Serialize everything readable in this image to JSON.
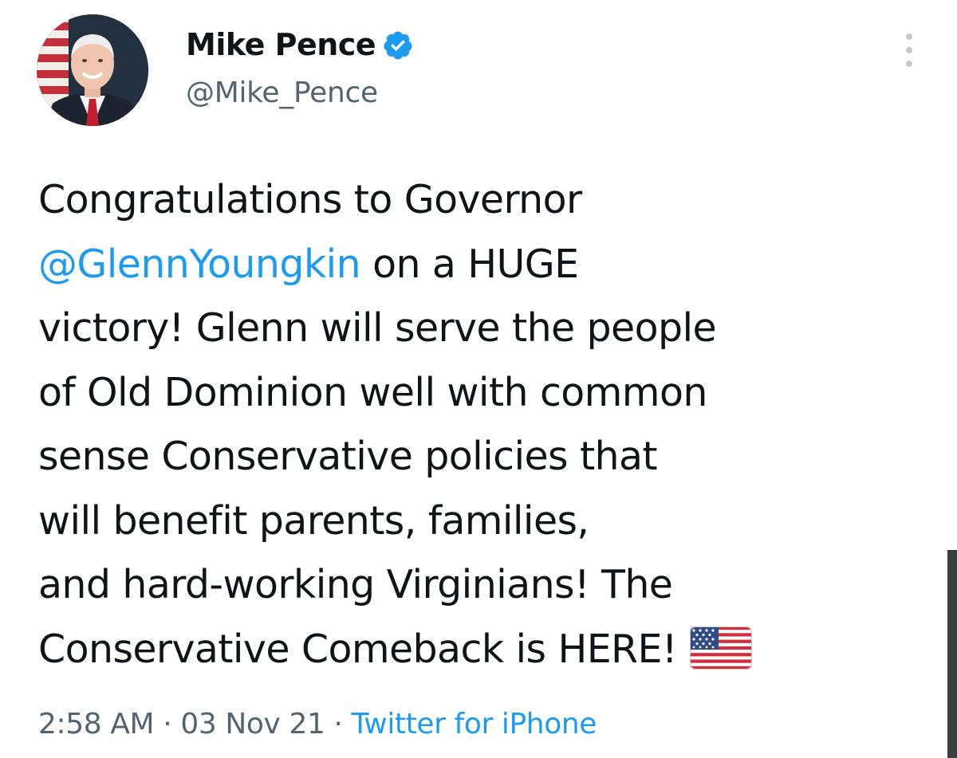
{
  "author": {
    "display_name": "Mike Pence",
    "handle": "@Mike_Pence",
    "verified": true
  },
  "tweet": {
    "lines": [
      {
        "pre": "Congratulations to Governor",
        "mention": "",
        "post": ""
      },
      {
        "pre": "",
        "mention": "@GlennYoungkin",
        "post": " on a HUGE"
      },
      {
        "pre": "victory! Glenn will serve the people",
        "mention": "",
        "post": ""
      },
      {
        "pre": "of Old Dominion well with common",
        "mention": "",
        "post": ""
      },
      {
        "pre": "sense Conservative policies that",
        "mention": "",
        "post": ""
      },
      {
        "pre": "will benefit parents, families,",
        "mention": "",
        "post": ""
      },
      {
        "pre": "and hard-working Virginians! The",
        "mention": "",
        "post": ""
      },
      {
        "pre": "Conservative Comeback is HERE!",
        "mention": "",
        "post": ""
      }
    ],
    "emoji": "us-flag-emoji"
  },
  "meta": {
    "time": "2:58 AM",
    "separator": "·",
    "date": "03 Nov 21",
    "source": "Twitter for iPhone"
  },
  "colors": {
    "text": "#0f1419",
    "secondary": "#536471",
    "link": "#1d9bf0",
    "verified": "#1d9bf0"
  },
  "icons": {
    "verified": "verified-badge-icon",
    "more": "more-dots-icon"
  }
}
